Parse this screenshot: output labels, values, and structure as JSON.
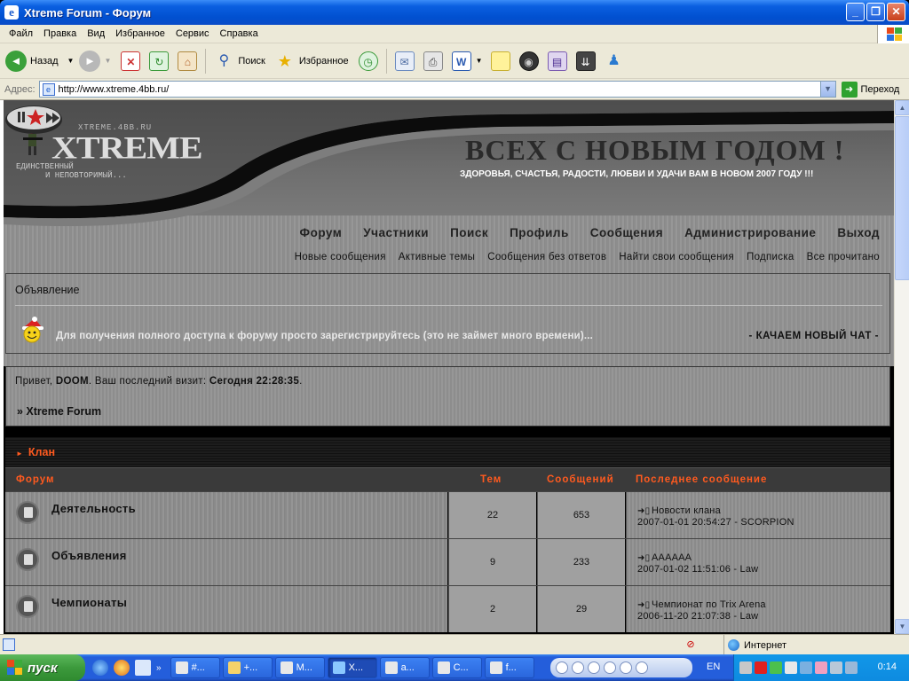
{
  "window": {
    "title": "Xtreme Forum - Форум",
    "controls": [
      "_",
      "❐",
      "✕"
    ]
  },
  "menu": [
    "Файл",
    "Правка",
    "Вид",
    "Избранное",
    "Сервис",
    "Справка"
  ],
  "toolbar": {
    "back": "Назад",
    "search": "Поиск",
    "favorites": "Избранное"
  },
  "address": {
    "label": "Адрес:",
    "url": "http://www.xtreme.4bb.ru/",
    "go": "Переход"
  },
  "site": {
    "logo_site": "XTREME.4BB.RU",
    "logo_text": "XTREME",
    "logo_tagline1": "ЕДИНСТВЕННЫЙ",
    "logo_tagline2": "И НЕПОВТОРИМЫЙ...",
    "headline": "ВСЕХ С НОВЫМ ГОДОМ !",
    "subheadline": "ЗДОРОВЬЯ, СЧАСТЬЯ, РАДОСТИ, ЛЮБВИ И УДАЧИ ВАМ В НОВОМ 2007 ГОДУ !!!",
    "main_nav": [
      "Форум",
      "Участники",
      "Поиск",
      "Профиль",
      "Сообщения",
      "Администрирование",
      "Выход"
    ],
    "sub_nav": [
      "Новые сообщения",
      "Активные темы",
      "Сообщения без ответов",
      "Найти свои сообщения",
      "Подписка",
      "Все прочитано"
    ]
  },
  "announcement": {
    "heading": "Объявление",
    "text": "Для получения полного доступа к форуму просто зарегистрируйтесь (это не займет много времени)...",
    "chat": "- КАЧАЕМ НОВЫЙ ЧАТ -"
  },
  "welcome": {
    "greeting_prefix": "Привет,",
    "username": "DOOM",
    "last_visit_label": ". Ваш последний визит:",
    "last_visit": "Сегодня 22:28:35",
    "end": ".",
    "breadcrumb": "» Xtreme Forum"
  },
  "category": {
    "title": "Клан",
    "columns": [
      "Форум",
      "Тем",
      "Сообщений",
      "Последнее сообщение"
    ],
    "forums": [
      {
        "name": "Деятельность",
        "topics": "22",
        "posts": "653",
        "last_title": "Новости клана",
        "last_meta": "2007-01-01 20:54:27 - SCORPION"
      },
      {
        "name": "Объявления",
        "topics": "9",
        "posts": "233",
        "last_title": "АААААА",
        "last_meta": "2007-01-02 11:51:06 - Law"
      },
      {
        "name": "Чемпионаты",
        "topics": "2",
        "posts": "29",
        "last_title": "Чемпионат по Trix Arena",
        "last_meta": "2006-11-20 21:07:38 - Law"
      }
    ]
  },
  "statusbar": {
    "zone": "Интернет"
  },
  "taskbar": {
    "start": "пуск",
    "tasks": [
      "#...",
      "+...",
      "M...",
      "X...",
      "a...",
      "C...",
      "f..."
    ],
    "lang": "EN",
    "clock": "0:14"
  },
  "colors": {
    "accent": "#ff5a1f",
    "xp_blue": "#0a5fe0",
    "chrome": "#ece9d8"
  }
}
